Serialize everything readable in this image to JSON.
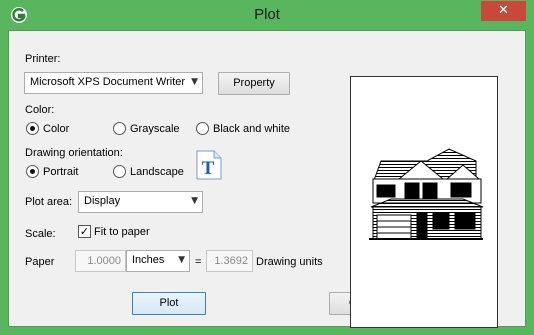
{
  "window": {
    "title": "Plot",
    "close_glyph": "✕",
    "icon": "app-logo-icon"
  },
  "printer": {
    "label": "Printer:",
    "selected": "Microsoft XPS Document Writer",
    "property_button": "Property"
  },
  "color": {
    "label": "Color:",
    "options": [
      {
        "label": "Color",
        "selected": true
      },
      {
        "label": "Grayscale",
        "selected": false
      },
      {
        "label": "Black and white",
        "selected": false
      }
    ]
  },
  "orientation": {
    "label": "Drawing orientation:",
    "options": [
      {
        "label": "Portrait",
        "selected": true
      },
      {
        "label": "Landscape",
        "selected": false
      }
    ],
    "icon_glyph": "T"
  },
  "plot_area": {
    "label": "Plot area:",
    "selected": "Display"
  },
  "scale": {
    "label": "Scale:",
    "fit_to_paper_label": "Fit to paper",
    "fit_to_paper_checked": true,
    "paper_label": "Paper",
    "paper_value": "1.0000",
    "units_selected": "Inches",
    "equals": "=",
    "drawing_value": "1.3692",
    "drawing_units_label": "Drawing units"
  },
  "buttons": {
    "plot": "Plot",
    "cancel": "Cancel"
  },
  "colors": {
    "title_bar": "#5ab55f",
    "close": "#c7493c",
    "dialog_bg": "#f0f0f0",
    "accent": "#1f5fa8"
  }
}
